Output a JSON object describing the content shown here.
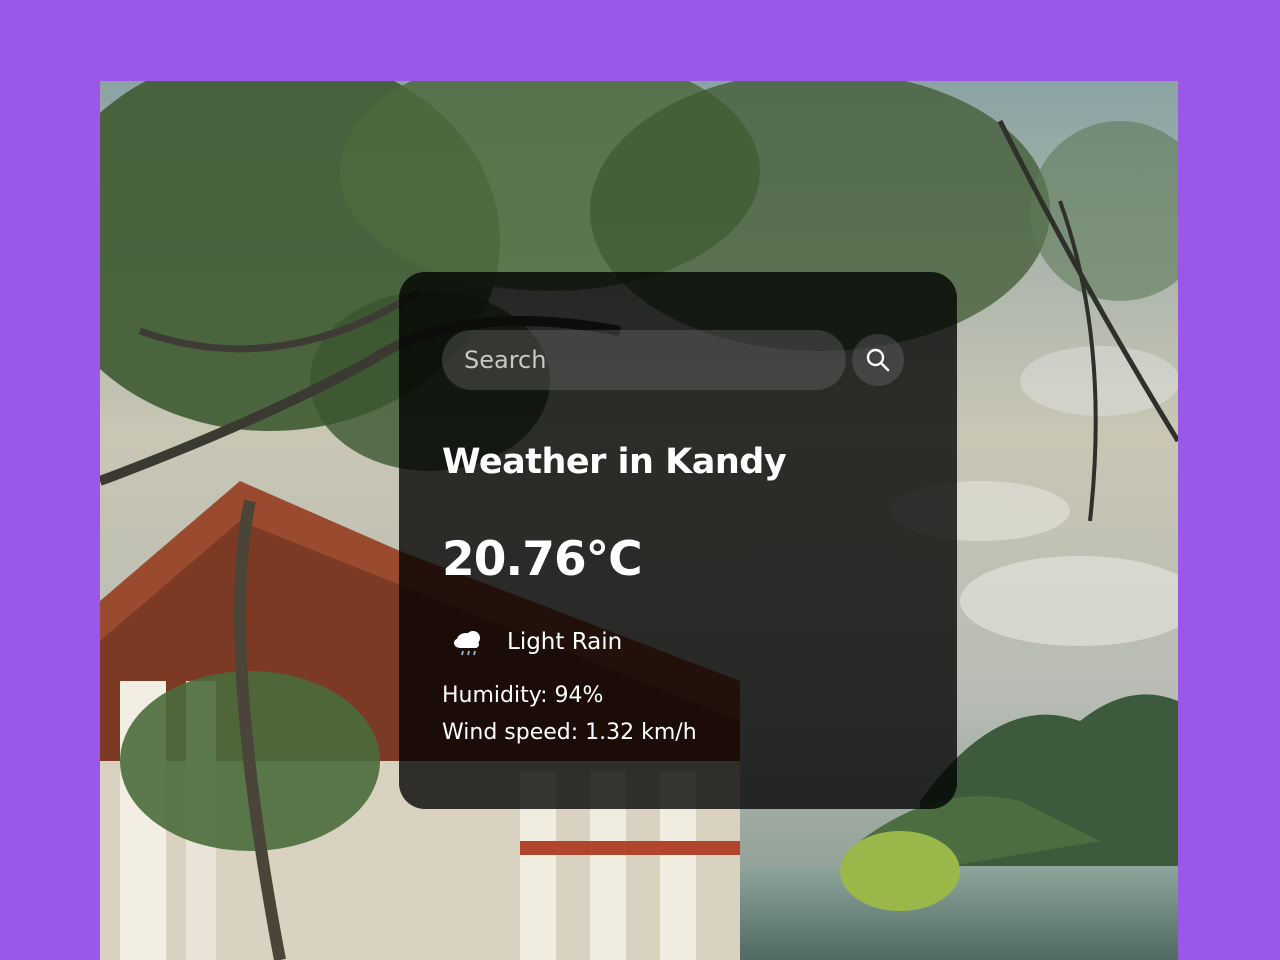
{
  "search": {
    "placeholder": "Search"
  },
  "weather": {
    "title": "Weather in Kandy",
    "temperature": "20.76°C",
    "description": "Light Rain",
    "humidity": "Humidity: 94%",
    "wind": "Wind speed: 1.32 km/h",
    "icon": "light-rain-cloud-icon"
  },
  "colors": {
    "page_background": "#9b57e8",
    "card_background": "rgba(0,0,0,0.78)",
    "text": "#ffffff"
  }
}
